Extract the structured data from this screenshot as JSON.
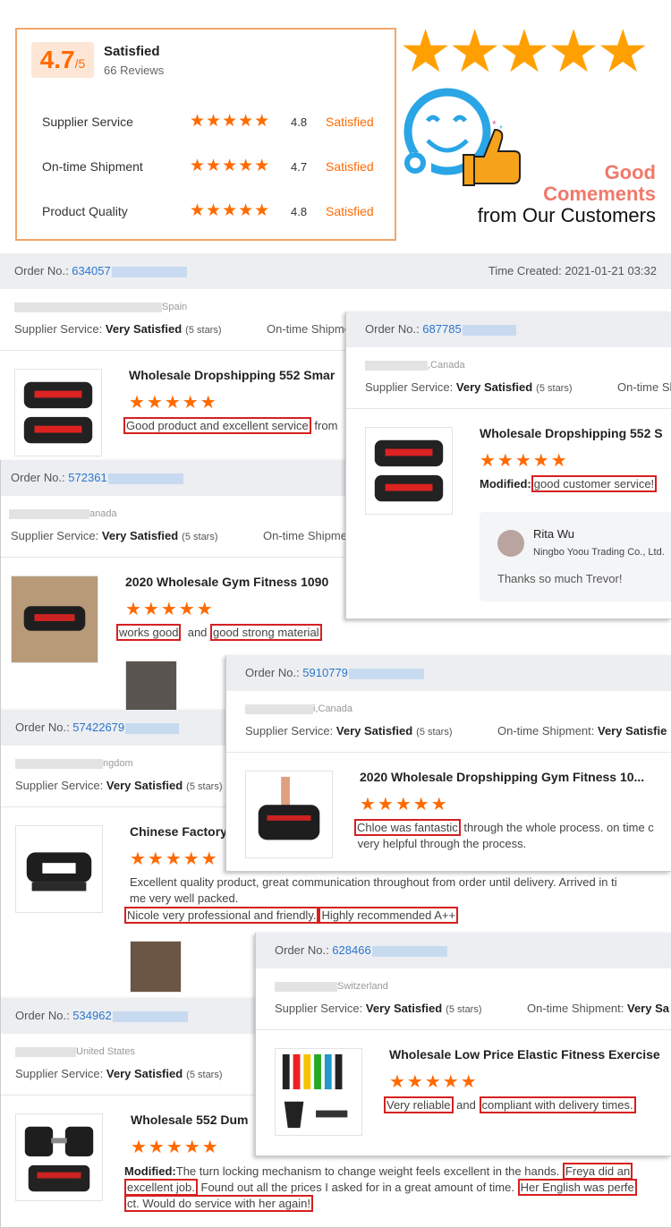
{
  "summary": {
    "score": "4.7",
    "score_suffix": "/5",
    "title": "Satisfied",
    "reviews": "66 Reviews",
    "rows": [
      {
        "label": "Supplier Service",
        "stars": "★★★★★",
        "value": "4.8",
        "status": "Satisfied"
      },
      {
        "label": "On-time Shipment",
        "stars": "★★★★★",
        "value": "4.7",
        "status": "Satisfied"
      },
      {
        "label": "Product Quality",
        "stars": "★★★★★",
        "value": "4.8",
        "status": "Satisfied"
      }
    ]
  },
  "banner": {
    "big_stars": "★★★★★",
    "line1": "Good",
    "line2": "Comements",
    "line3": "from Our Customers"
  },
  "labels": {
    "order_no": "Order No.: ",
    "supplier_service": "Supplier Service: ",
    "very_satisfied": "Very Satisfied",
    "five_stars": "(5 stars)",
    "ontime": "On-time Shipment: ",
    "modified": "Modified:",
    "stars": "★★★★★"
  },
  "orders": [
    {
      "order_num": "634057",
      "time_created": "Time Created: 2021-01-21 03:32",
      "location": "Spain",
      "product": "Wholesale Dropshipping 552 Smar",
      "comment_hl1": "Good product and excellent service",
      "comment_rest": " from"
    },
    {
      "order_num": "572361",
      "location": "anada",
      "product": "2020 Wholesale Gym Fitness 1090",
      "comment_hl1": "works good",
      "comment_mid": "and",
      "comment_hl2": "good strong material"
    },
    {
      "order_num": "57422679",
      "location": "ngdom",
      "product": "Chinese Factory",
      "comment_plain1": "Excellent quality product, great communication throughout from order until delivery. Arrived in ti",
      "comment_plain2": "me  very well packed.",
      "comment_hl1": "Nicole very professional and friendly.",
      "comment_hl2": "Highly recommended A++"
    },
    {
      "order_num": "534962",
      "location": "United States",
      "product": "Wholesale 552 Dum",
      "comment_plain1": "The turn locking mechanism to change weight feels excellent in the hands.",
      "comment_hl1a": "Freya did an",
      "comment_hl1b": "excellent job.",
      "comment_plain2": " Found out all the prices I asked for in a great amount of time.",
      "comment_hl2a": "Her English was perfe",
      "comment_hl2b": "ct. Would do service with her again!"
    },
    {
      "order_num": "687785",
      "location": ",Canada",
      "product": "Wholesale Dropshipping 552 S",
      "comment_hl1": "good customer service!",
      "reply_name": "Rita Wu",
      "reply_company": "Ningbo Yoou Trading Co., Ltd.",
      "reply_text": "Thanks so much Trevor!"
    },
    {
      "order_num": "5910779",
      "location": "i,Canada",
      "ontime_value": "Very Satisfie",
      "product": "2020 Wholesale Dropshipping Gym Fitness 10...",
      "comment_hl1": "Chloe was fantastic",
      "comment_rest1": " through the whole process. on time c",
      "comment_rest2": "very helpful through the process."
    },
    {
      "order_num": "628466",
      "location": "Switzerland",
      "ontime_value": "Very Sa",
      "product": "Wholesale Low Price Elastic Fitness Exercise",
      "comment_hl1": "Very reliable",
      "comment_mid": "and",
      "comment_hl2": "compliant with delivery times."
    }
  ],
  "colors": {
    "accent": "#ff6a00",
    "gold": "#ffa000",
    "link": "#2a76cc",
    "highlight_border": "#d62020",
    "header_bg": "#eceef1"
  }
}
